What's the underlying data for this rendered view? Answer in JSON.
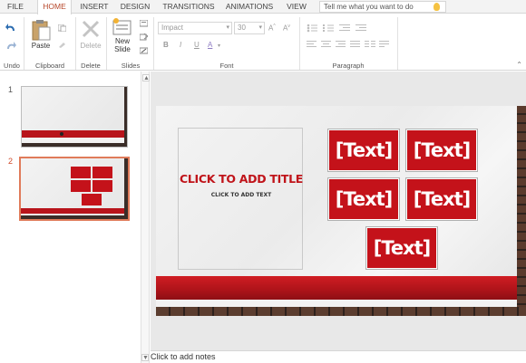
{
  "tabs": [
    {
      "label": "FILE"
    },
    {
      "label": "HOME"
    },
    {
      "label": "INSERT"
    },
    {
      "label": "DESIGN"
    },
    {
      "label": "TRANSITIONS"
    },
    {
      "label": "ANIMATIONS"
    },
    {
      "label": "VIEW"
    }
  ],
  "active_tab": "HOME",
  "tell_me": {
    "placeholder": "Tell me what you want to do"
  },
  "ribbon": {
    "undo_group": "Undo",
    "clipboard": {
      "paste": "Paste",
      "label": "Clipboard"
    },
    "delete": {
      "button": "Delete",
      "label": "Delete"
    },
    "slides": {
      "new_slide_line1": "New",
      "new_slide_line2": "Slide",
      "label": "Slides"
    },
    "font": {
      "name": "Impact",
      "size": "30",
      "bold": "B",
      "italic": "I",
      "underline": "U",
      "strike": "abc",
      "color": "A",
      "label": "Font"
    },
    "paragraph": {
      "label": "Paragraph"
    }
  },
  "thumbnails": [
    {
      "number": "1"
    },
    {
      "number": "2"
    }
  ],
  "slide": {
    "title_placeholder": "CLICK TO ADD TITLE",
    "subtitle_placeholder": "CLICK TO ADD TEXT",
    "text_boxes": [
      "[Text]",
      "[Text]",
      "[Text]",
      "[Text]",
      "[Text]"
    ]
  },
  "notes": {
    "placeholder": "Click to add notes"
  },
  "colors": {
    "accent": "#b7472a",
    "slide_red": "#c4121a"
  }
}
